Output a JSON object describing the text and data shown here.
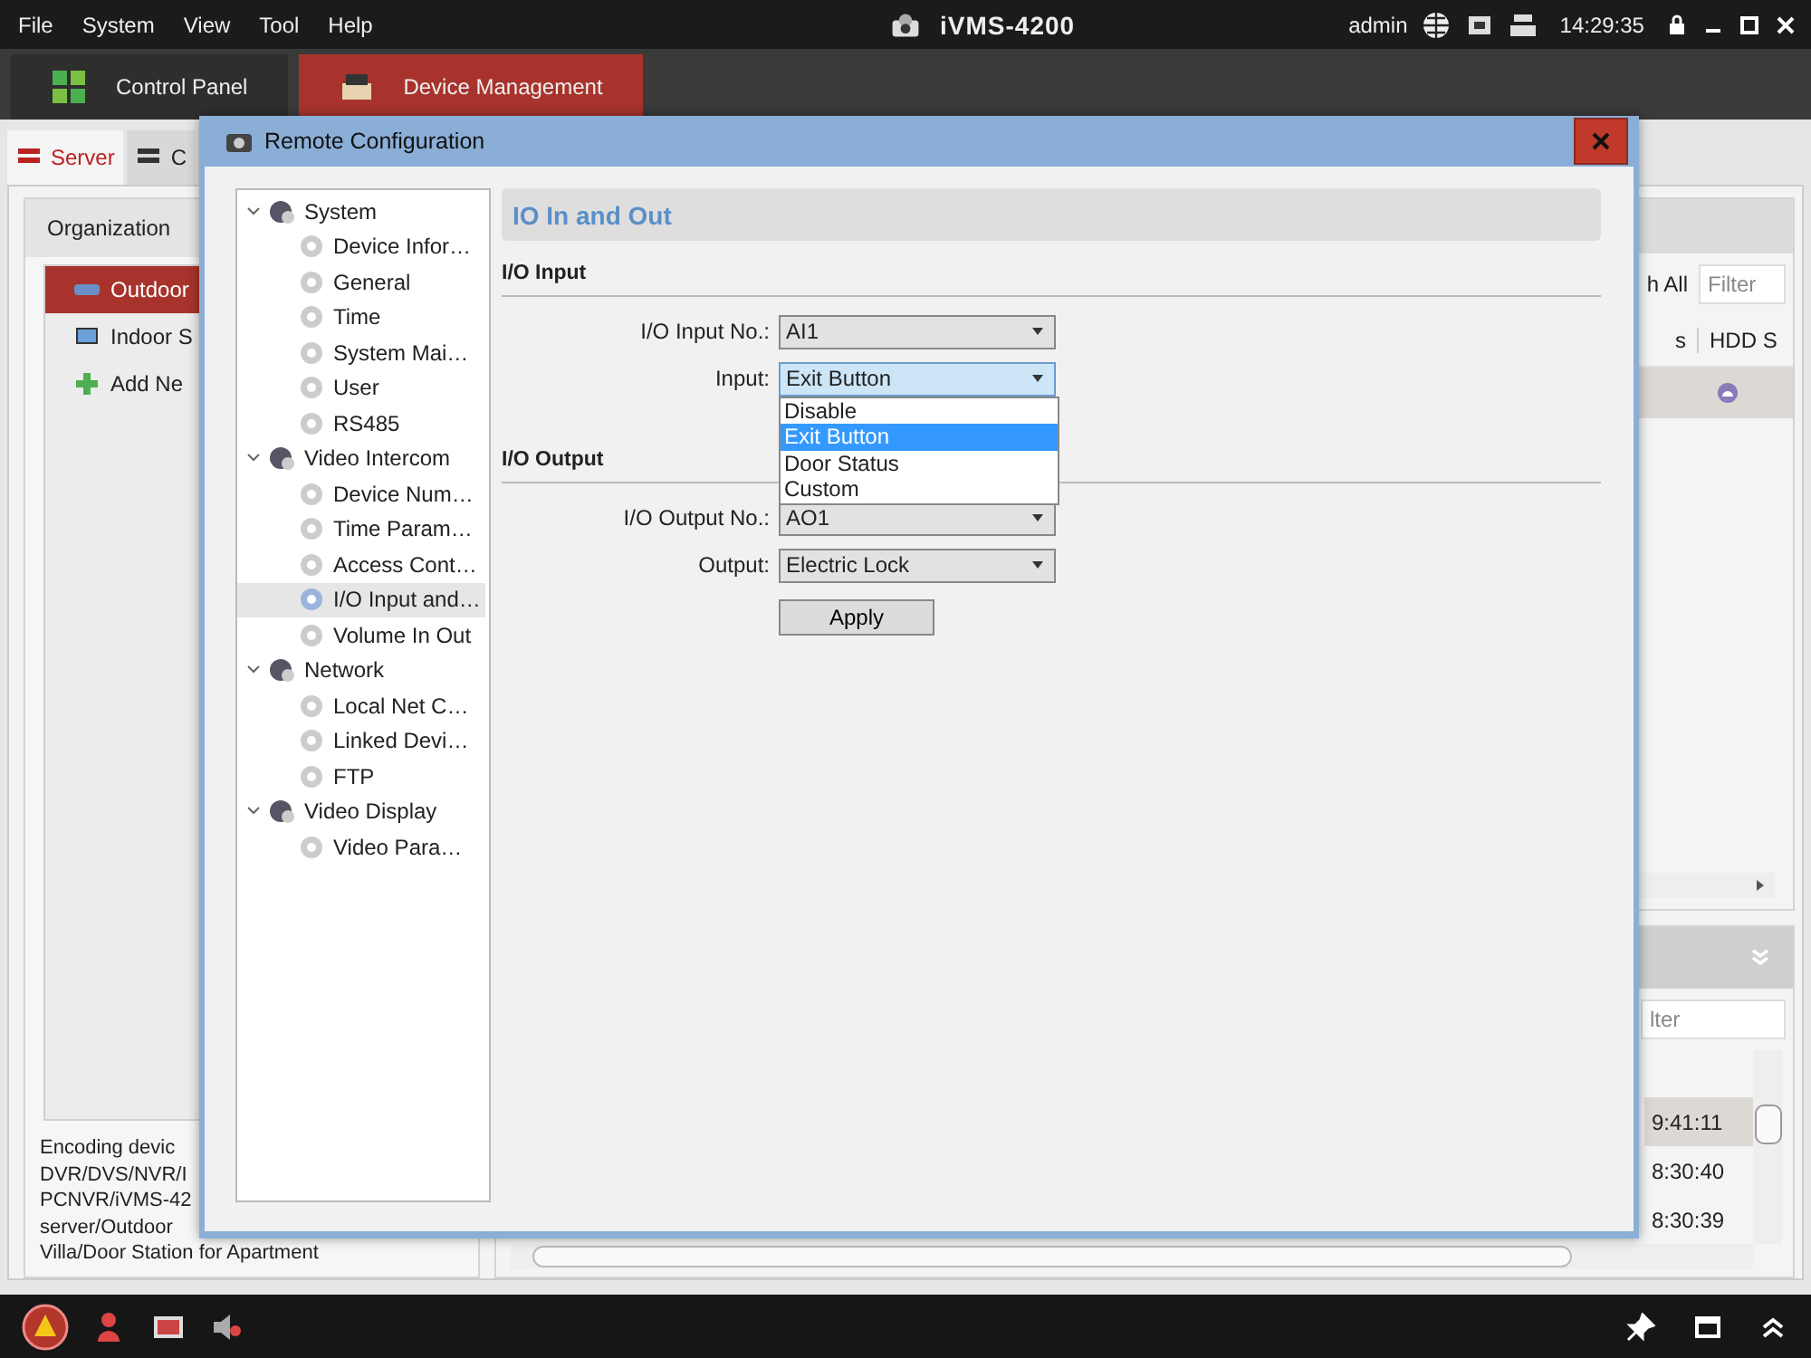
{
  "menu": [
    "File",
    "System",
    "View",
    "Tool",
    "Help"
  ],
  "app_title": "iVMS-4200",
  "user": "admin",
  "clock": "14:29:35",
  "main_tabs": [
    {
      "label": "Control Panel",
      "kind": "grid",
      "selected": false
    },
    {
      "label": "Device Management",
      "kind": "device",
      "selected": true
    }
  ],
  "sub_tabs": [
    {
      "label": "Server",
      "selected": true
    },
    {
      "label": "C",
      "selected": false
    }
  ],
  "organization": {
    "title": "Organization",
    "items": [
      {
        "label": "Outdoor",
        "kind": "outdoor",
        "selected": true
      },
      {
        "label": "Indoor S",
        "kind": "indoor",
        "selected": false
      },
      {
        "label": "Add Ne",
        "kind": "add",
        "selected": false
      }
    ]
  },
  "description": [
    "Encoding devic",
    "DVR/DVS/NVR/I",
    "PCNVR/iVMS-42",
    "server/Outdoor",
    "Villa/Door Station for Apartment"
  ],
  "device_panel": {
    "search_all": "h All",
    "filter_placeholder": "Filter",
    "columns": [
      "s",
      "HDD S"
    ],
    "rows": [
      {
        "selected": true
      }
    ]
  },
  "log_panel": {
    "filter_placeholder": "lter",
    "rows": [
      {
        "time": "9:41:11",
        "selected": true
      },
      {
        "time": "8:30:40",
        "selected": false
      },
      {
        "time": "8:30:39",
        "selected": false
      }
    ]
  },
  "dialog": {
    "title": "Remote Configuration",
    "tree": [
      {
        "label": "System",
        "expanded": true,
        "children": [
          {
            "label": "Device Infor…",
            "selected": false
          },
          {
            "label": "General",
            "selected": false
          },
          {
            "label": "Time",
            "selected": false
          },
          {
            "label": "System Mai…",
            "selected": false
          },
          {
            "label": "User",
            "selected": false
          },
          {
            "label": "RS485",
            "selected": false
          }
        ]
      },
      {
        "label": "Video Intercom",
        "expanded": true,
        "children": [
          {
            "label": "Device Num…",
            "selected": false
          },
          {
            "label": "Time Param…",
            "selected": false
          },
          {
            "label": "Access Cont…",
            "selected": false
          },
          {
            "label": "I/O Input and…",
            "selected": true
          },
          {
            "label": "Volume In Out",
            "selected": false
          }
        ]
      },
      {
        "label": "Network",
        "expanded": true,
        "children": [
          {
            "label": "Local Net C…",
            "selected": false
          },
          {
            "label": "Linked Devi…",
            "selected": false
          },
          {
            "label": "FTP",
            "selected": false
          }
        ]
      },
      {
        "label": "Video Display",
        "expanded": true,
        "children": [
          {
            "label": "Video Para…",
            "selected": false
          }
        ]
      }
    ],
    "page_title": "IO In and Out",
    "sections": [
      {
        "title": "I/O Input",
        "fields": [
          {
            "label": "I/O Input No.:",
            "value": "AI1",
            "open": false
          },
          {
            "label": "Input:",
            "value": "Exit Button",
            "open": true,
            "options": [
              {
                "label": "Disable",
                "selected": false
              },
              {
                "label": "Exit Button",
                "selected": true
              },
              {
                "label": "Door Status",
                "selected": false
              },
              {
                "label": "Custom",
                "selected": false
              }
            ]
          }
        ]
      },
      {
        "title": "I/O Output",
        "fields": [
          {
            "label": "I/O Output No.:",
            "value": "AO1",
            "open": false
          },
          {
            "label": "Output:",
            "value": "Electric Lock",
            "open": false
          }
        ]
      }
    ],
    "apply": "Apply"
  }
}
